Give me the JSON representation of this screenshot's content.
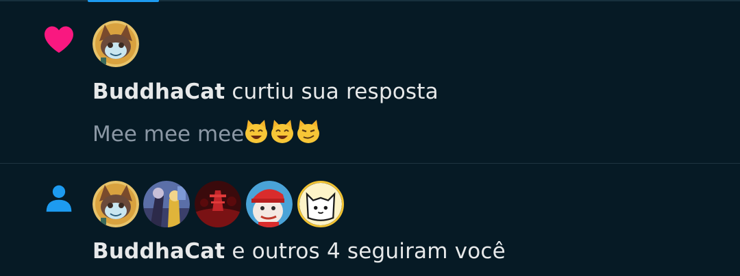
{
  "colors": {
    "background": "#061a25",
    "like_pink": "#f91880",
    "follow_blue": "#1d9bf0",
    "text_primary": "#e7e9ea",
    "text_secondary": "#8b98a5"
  },
  "notifications": [
    {
      "type": "like",
      "icon": "heart-icon",
      "actor": "BuddhaCat",
      "action": " curtiu sua resposta",
      "preview": "Mee mee mee",
      "preview_emojis": [
        "smiling-cat-emoji",
        "smiling-cat-emoji",
        "smirking-cat-emoji"
      ]
    },
    {
      "type": "follow",
      "icon": "person-icon",
      "actor": "BuddhaCat",
      "action": " e outros 4 seguiram você",
      "avatars": [
        "buddhacat-avatar",
        "group-art-avatar",
        "red-scene-avatar",
        "red-cap-avatar",
        "white-cat-avatar"
      ]
    }
  ]
}
